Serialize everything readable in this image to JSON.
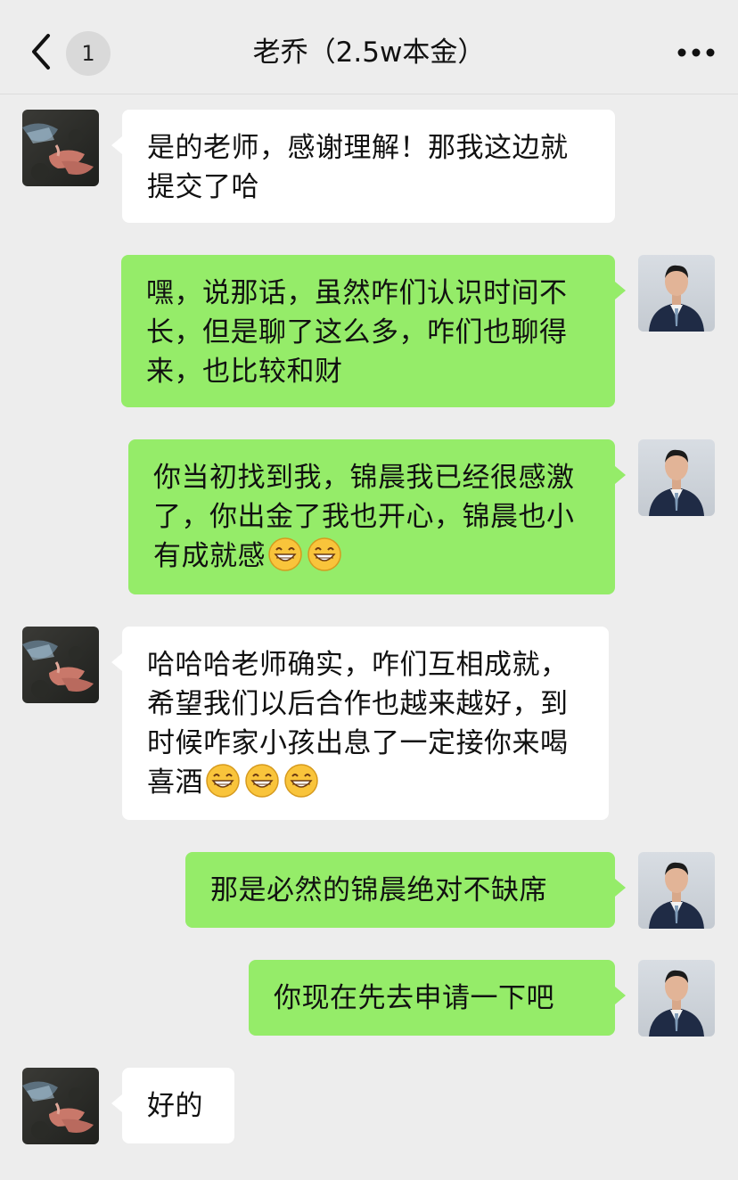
{
  "header": {
    "title": "老乔（2.5w本金）",
    "unread_count": "1",
    "back_icon": "chevron-left-icon",
    "more_icon": "more-dots-icon"
  },
  "colors": {
    "background": "#ededed",
    "bubble_self": "#95ec69",
    "bubble_other": "#ffffff"
  },
  "messages": [
    {
      "side": "left",
      "text": "是的老师，感谢理解！那我这边就提交了哈"
    },
    {
      "side": "right",
      "text": "嘿，说那话，虽然咋们认识时间不长，但是聊了这么多，咋们也聊得来，也比较和财"
    },
    {
      "side": "right",
      "text": "你当初找到我，锦晨我已经很感激了，你出金了我也开心，锦晨也小有成就感",
      "emoji": [
        "grin-emoji",
        "grin-emoji"
      ]
    },
    {
      "side": "left",
      "text": "哈哈哈老师确实，咋们互相成就，希望我们以后合作也越来越好，到时候咋家小孩出息了一定接你来喝喜酒",
      "emoji": [
        "grin-emoji",
        "grin-emoji",
        "grin-emoji"
      ]
    },
    {
      "side": "right",
      "text": "那是必然的锦晨绝对不缺席"
    },
    {
      "side": "right",
      "text": "你现在先去申请一下吧"
    },
    {
      "side": "left",
      "text": "好的"
    }
  ]
}
